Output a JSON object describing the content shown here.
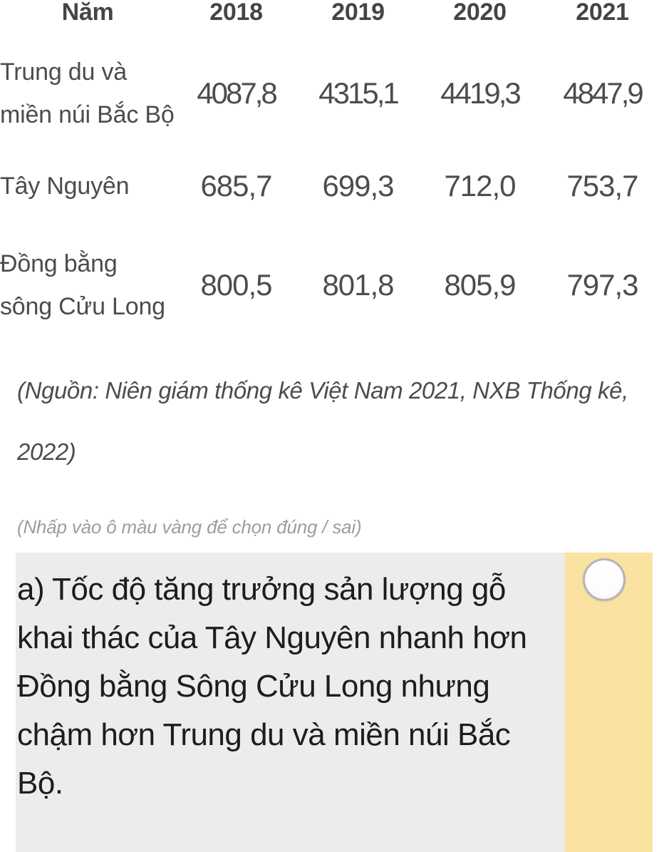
{
  "table": {
    "headers": [
      "Năm",
      "2018",
      "2019",
      "2020",
      "2021"
    ],
    "rows": [
      {
        "label": "Trung du và miền núi Bắc Bộ",
        "values": [
          "4087,8",
          "4315,1",
          "4419,3",
          "4847,9"
        ]
      },
      {
        "label": "Tây Nguyên",
        "values": [
          "685,7",
          "699,3",
          "712,0",
          "753,7"
        ]
      },
      {
        "label": "Đồng bằng sông Cửu Long",
        "values": [
          "800,5",
          "801,8",
          "805,9",
          "797,3"
        ]
      }
    ]
  },
  "source_note": "(Nguồn: Niên giám thống kê Việt Nam 2021, NXB Thống kê, 2022)",
  "hint": "(Nhấp vào ô màu vàng để chọn đúng / sai)",
  "statement": {
    "text": "a) Tốc độ tăng trưởng sản lượng gỗ khai thác của Tây Nguyên nhanh hơn Đồng bằng Sông Cửu Long nhưng chậm hơn Trung du và miền núi Bắc Bộ."
  },
  "colors": {
    "statement_background": "#ececec",
    "answer_background": "#fae2a0",
    "radio_border": "#b4b4bb",
    "text_dark": "#1b1d20",
    "text_grey": "#4c4c4c",
    "hint_grey": "#9d9d9d"
  }
}
